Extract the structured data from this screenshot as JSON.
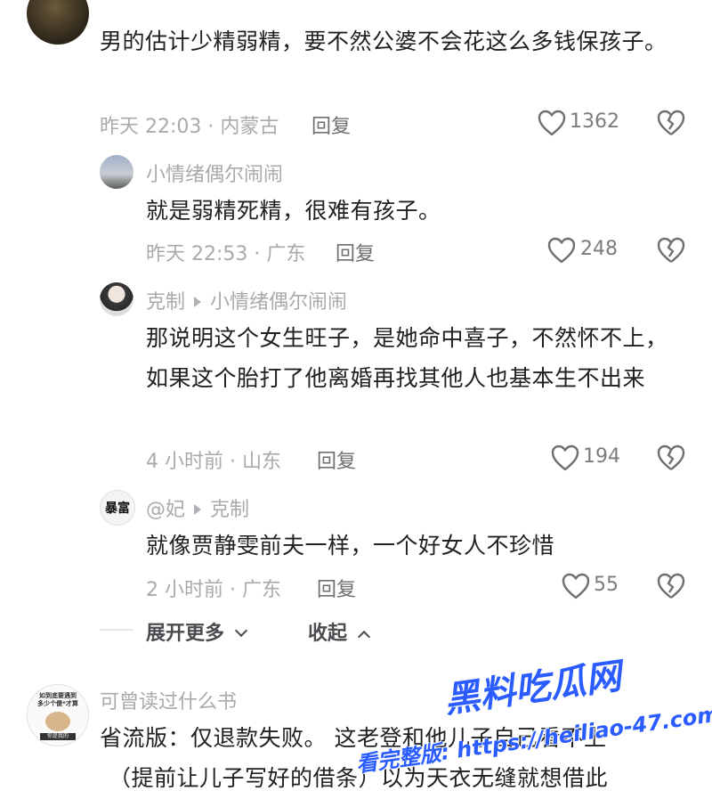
{
  "comments": [
    {
      "text": "男的估计少精弱精，要不然公婆不会花这么多钱保孩子。",
      "meta": "昨天 22:03 · 内蒙古",
      "reply": "回复",
      "likes": "1362"
    },
    {
      "author": "小情绪偶尔闹闹",
      "text": "就是弱精死精，很难有孩子。",
      "meta": "昨天 22:53 · 广东",
      "reply": "回复",
      "likes": "248"
    },
    {
      "author": "克制",
      "reply_to": "小情绪偶尔闹闹",
      "text": "那说明这个女生旺子，是她命中喜子，不然怀不上，如果这个胎打了他离婚再找其他人也基本生不出来",
      "meta": "4 小时前 · 山东",
      "reply": "回复",
      "likes": "194"
    },
    {
      "author": "@妃",
      "reply_to": "克制",
      "text": "就像贾静雯前夫一样，一个好女人不珍惜",
      "meta": "2 小时前 · 广东",
      "reply": "回复",
      "likes": "55"
    },
    {
      "author": "可曾读过什么书",
      "text_line1": "省流版：仅退款失败。 这老登和他儿子自己看不上",
      "text_line2": "（提前让儿子写好的借条）以为天衣无缝就想借此",
      "avatar_text": "如到底要遇到\n多少个傻*才算",
      "avatar_caption": "你是我的"
    }
  ],
  "thread_controls": {
    "expand_label": "展开更多",
    "collapse_label": "收起"
  },
  "avatar_badge_text": "暴富",
  "watermark": {
    "title": "黑料吃瓜网",
    "line": "看完整版: https://heiliao-47.com"
  },
  "colors": {
    "text": "#202124",
    "meta": "#a9a9ae",
    "watermark": "#2a5cff"
  }
}
